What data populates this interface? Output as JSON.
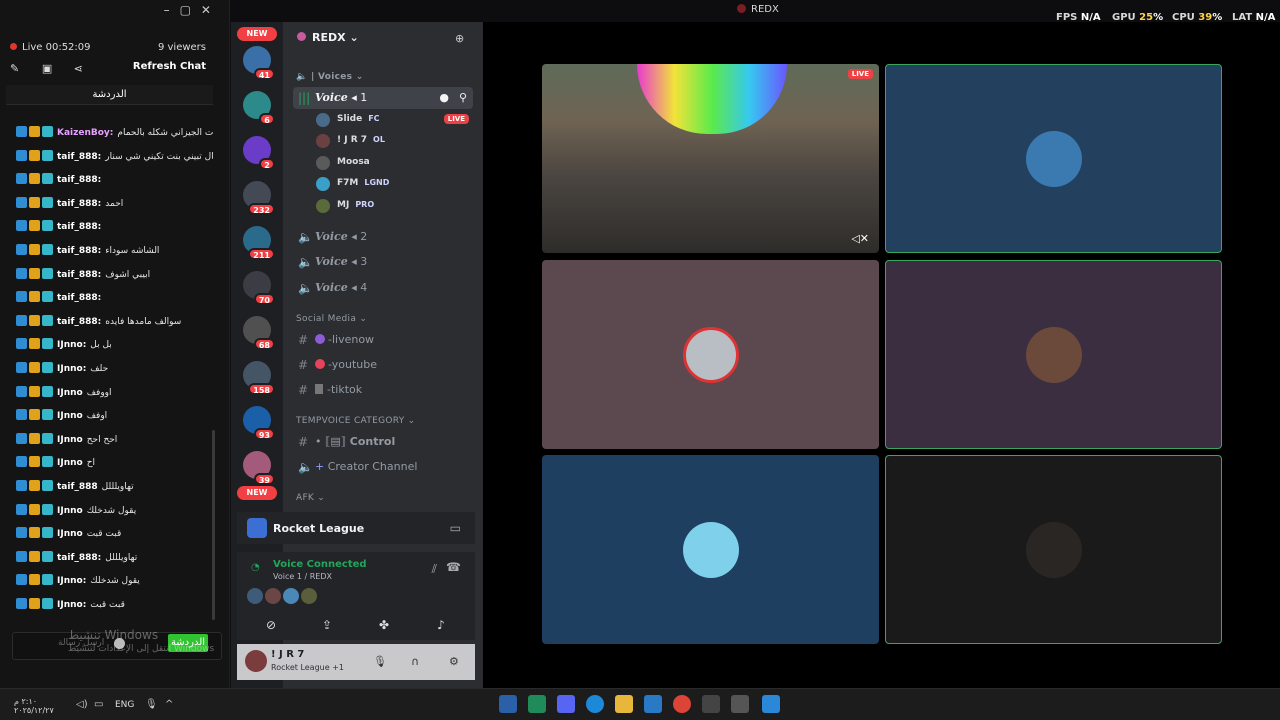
{
  "window": {
    "title": "REDX"
  },
  "perf": {
    "fps_label": "FPS",
    "fps_value": "N/A",
    "gpu_label": "GPU",
    "gpu_value": "25",
    "cpu_label": "CPU",
    "cpu_value": "39",
    "lat_label": "LAT",
    "lat_value": "N/A"
  },
  "chat": {
    "live_time": "Live 00:52:09",
    "viewers": "9 viewers",
    "refresh_label": "Refresh Chat",
    "tab_label": "الدردشة",
    "messages": [
      {
        "name": "KaizenBoy:",
        "text": "شف سوت الجيزاني شكله بالحمام"
      },
      {
        "name": "taif_888:",
        "text": "ترانال تبيني بنت تكيني شي سنار"
      },
      {
        "name": "taif_888:",
        "text": ""
      },
      {
        "name": "taif_888:",
        "text": "احمد"
      },
      {
        "name": "taif_888:",
        "text": ""
      },
      {
        "name": "taif_888:",
        "text": "الشاشه سوداء"
      },
      {
        "name": "taif_888:",
        "text": "ابيبي اشوف"
      },
      {
        "name": "taif_888:",
        "text": ""
      },
      {
        "name": "taif_888:",
        "text": "سوالف مامدها فايده"
      },
      {
        "name": "IJnno:",
        "text": "بل بل"
      },
      {
        "name": "IJnno:",
        "text": "حلف"
      },
      {
        "name": "IJnno",
        "text": "اووفف"
      },
      {
        "name": "IJnno",
        "text": "اوفف"
      },
      {
        "name": "IJnno",
        "text": "احح احح"
      },
      {
        "name": "IJnno",
        "text": "اح"
      },
      {
        "name": "taif_888",
        "text": "تهاويلللل"
      },
      {
        "name": "IJnno",
        "text": "يقول شدخلك"
      },
      {
        "name": "IJnno",
        "text": "قبت قبت"
      },
      {
        "name": "taif_888:",
        "text": "تهاويلللل"
      },
      {
        "name": "IJnno:",
        "text": "يقول شدخلك"
      },
      {
        "name": "IJnno:",
        "text": "قبت قبت"
      }
    ],
    "input_placeholder": "ارسل رسالة",
    "send_label": "الدردشة",
    "watermark_line1": "تنشيط Windows",
    "watermark_line2": "انتقل إلى الإعدادات لتنشيط Windows"
  },
  "rail": {
    "new_label": "NEW",
    "counts": [
      "41",
      "6",
      "2",
      "232",
      "211",
      "70",
      "68",
      "158",
      "93",
      "39"
    ]
  },
  "guild": {
    "name": "REDX"
  },
  "channels": {
    "voices_category": "| Voices",
    "active_voice": "Voice",
    "active_voice_num": "1",
    "voice2": "Voice",
    "voice2_num": "2",
    "voice3": "Voice",
    "voice3_num": "3",
    "voice4": "Voice",
    "voice4_num": "4",
    "social_category": "Social Media",
    "ch_livenow": "-livenow",
    "ch_youtube": "-youtube",
    "ch_tiktok": "-tiktok",
    "temp_category": "TEMPVOICE CATEGORY",
    "ch_control": "Control",
    "ch_creator": "Creator Channel",
    "afk_category": "AFK"
  },
  "voice_users": [
    {
      "name": "Slide",
      "tag": "FC",
      "live": "LIVE"
    },
    {
      "name": "! J R 7",
      "tag": "OL",
      "live": ""
    },
    {
      "name": "Moosa",
      "tag": "",
      "live": ""
    },
    {
      "name": "F7M",
      "tag": "LGND",
      "live": ""
    },
    {
      "name": "MJ",
      "tag": "PRO",
      "live": ""
    }
  ],
  "activity": {
    "name": "Rocket League"
  },
  "voice_panel": {
    "title": "Voice Connected",
    "sub": "Voice 1 / REDX"
  },
  "user": {
    "name": "! J R 7",
    "status": "Rocket League +1"
  },
  "stage": {
    "live_tag": "LIVE"
  },
  "taskbar": {
    "time": "٢:١٠ م",
    "date": "٢٠٢٥/١٢/٢٧",
    "lang": "ENG"
  },
  "colors": {
    "accent": "#5865f2",
    "live": "#ed4245",
    "speaking": "#3ba55c"
  }
}
